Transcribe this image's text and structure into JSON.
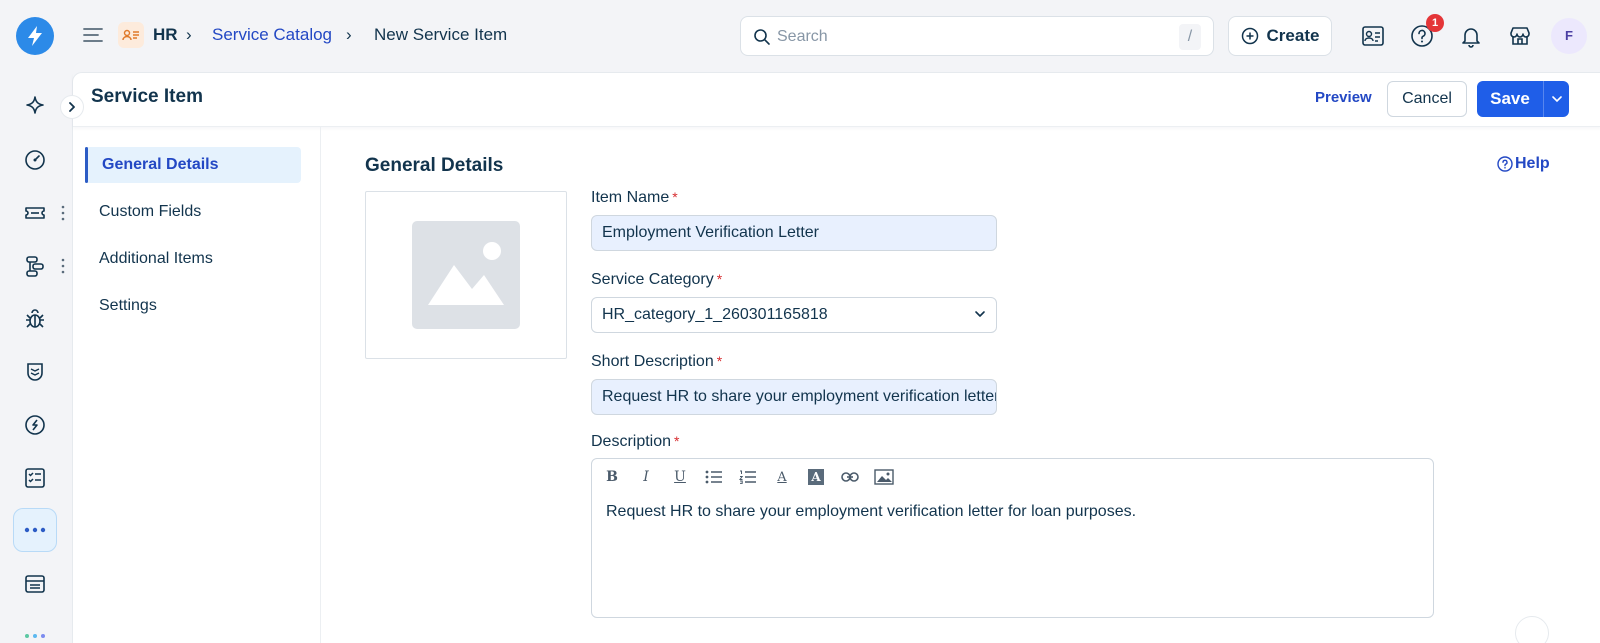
{
  "breadcrumb": {
    "module": "HR",
    "separator": "›",
    "catalog": "Service Catalog",
    "current": "New Service Item"
  },
  "search": {
    "placeholder": "Search",
    "shortcut": "/"
  },
  "header": {
    "create_label": "Create",
    "help_badge_count": "1",
    "avatar_initial": "F"
  },
  "rail": {
    "icons": [
      "sparkle-icon",
      "dashboard-icon",
      "ticket-icon",
      "workflow-icon",
      "bug-icon",
      "shield-icon",
      "compass-icon",
      "checklist-icon",
      "more-icon",
      "table-icon"
    ]
  },
  "panel": {
    "title": "Service Item",
    "preview_label": "Preview",
    "cancel_label": "Cancel",
    "save_label": "Save"
  },
  "side_nav": {
    "items": [
      {
        "label": "General Details",
        "active": true
      },
      {
        "label": "Custom Fields",
        "active": false
      },
      {
        "label": "Additional Items",
        "active": false
      },
      {
        "label": "Settings",
        "active": false
      }
    ]
  },
  "form": {
    "section_title": "General Details",
    "help_label": "Help",
    "required_mark": "*",
    "item_name": {
      "label": "Item Name",
      "value": "Employment Verification Letter"
    },
    "service_category": {
      "label": "Service Category",
      "value": "HR_category_1_260301165818"
    },
    "short_description": {
      "label": "Short Description",
      "value": "Request HR to share your employment verification letter"
    },
    "description": {
      "label": "Description",
      "value": "Request HR to share your employment verification letter for loan purposes."
    }
  },
  "editor_toolbar": {
    "bold": "B",
    "italic": "I",
    "underline": "U",
    "font_color": "A",
    "bg_color": "A"
  },
  "colors": {
    "accent": "#2348c4",
    "primary_button": "#1f5ee8",
    "logo": "#2c8ae8",
    "badge": "#e43538",
    "active_nav_bg": "#e5f2fd",
    "autofill_bg": "#e8f0fe"
  }
}
